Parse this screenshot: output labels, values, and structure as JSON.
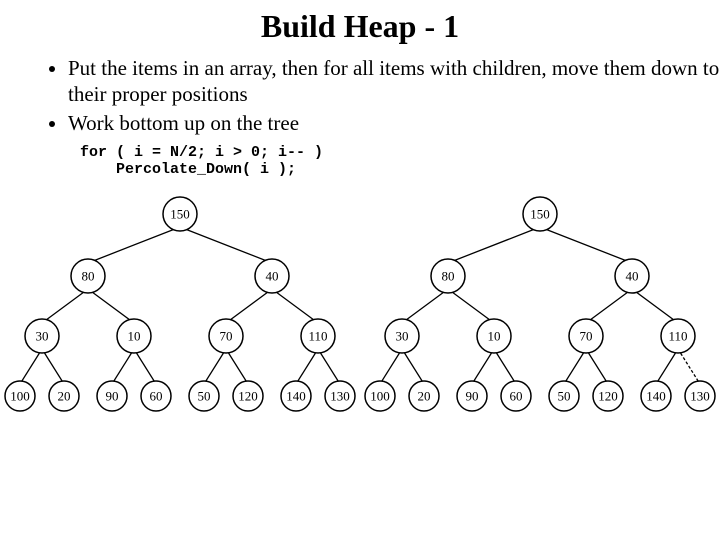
{
  "title": "Build Heap - 1",
  "bullets": [
    "Put the items in an array, then for all items with children, move them down to their proper positions",
    "Work bottom up on the tree"
  ],
  "code_line1": "for ( i = N/2; i > 0; i-- )",
  "code_line2": "    Percolate_Down( i );",
  "trees": {
    "left": {
      "root": "150",
      "L": "80",
      "R": "40",
      "LL": "30",
      "LR": "10",
      "RL": "70",
      "RR": "110",
      "LLL": "100",
      "LLR": "20",
      "LRL": "90",
      "LRR": "60",
      "RLL": "50",
      "RLR": "120",
      "RRL": "140",
      "RRR": "130",
      "dashed_last": false
    },
    "right": {
      "root": "150",
      "L": "80",
      "R": "40",
      "LL": "30",
      "LR": "10",
      "RL": "70",
      "RR": "110",
      "LLL": "100",
      "LLR": "20",
      "LRL": "90",
      "LRR": "60",
      "RLL": "50",
      "RLR": "120",
      "RRL": "140",
      "RRR": "130",
      "dashed_last": true
    }
  }
}
